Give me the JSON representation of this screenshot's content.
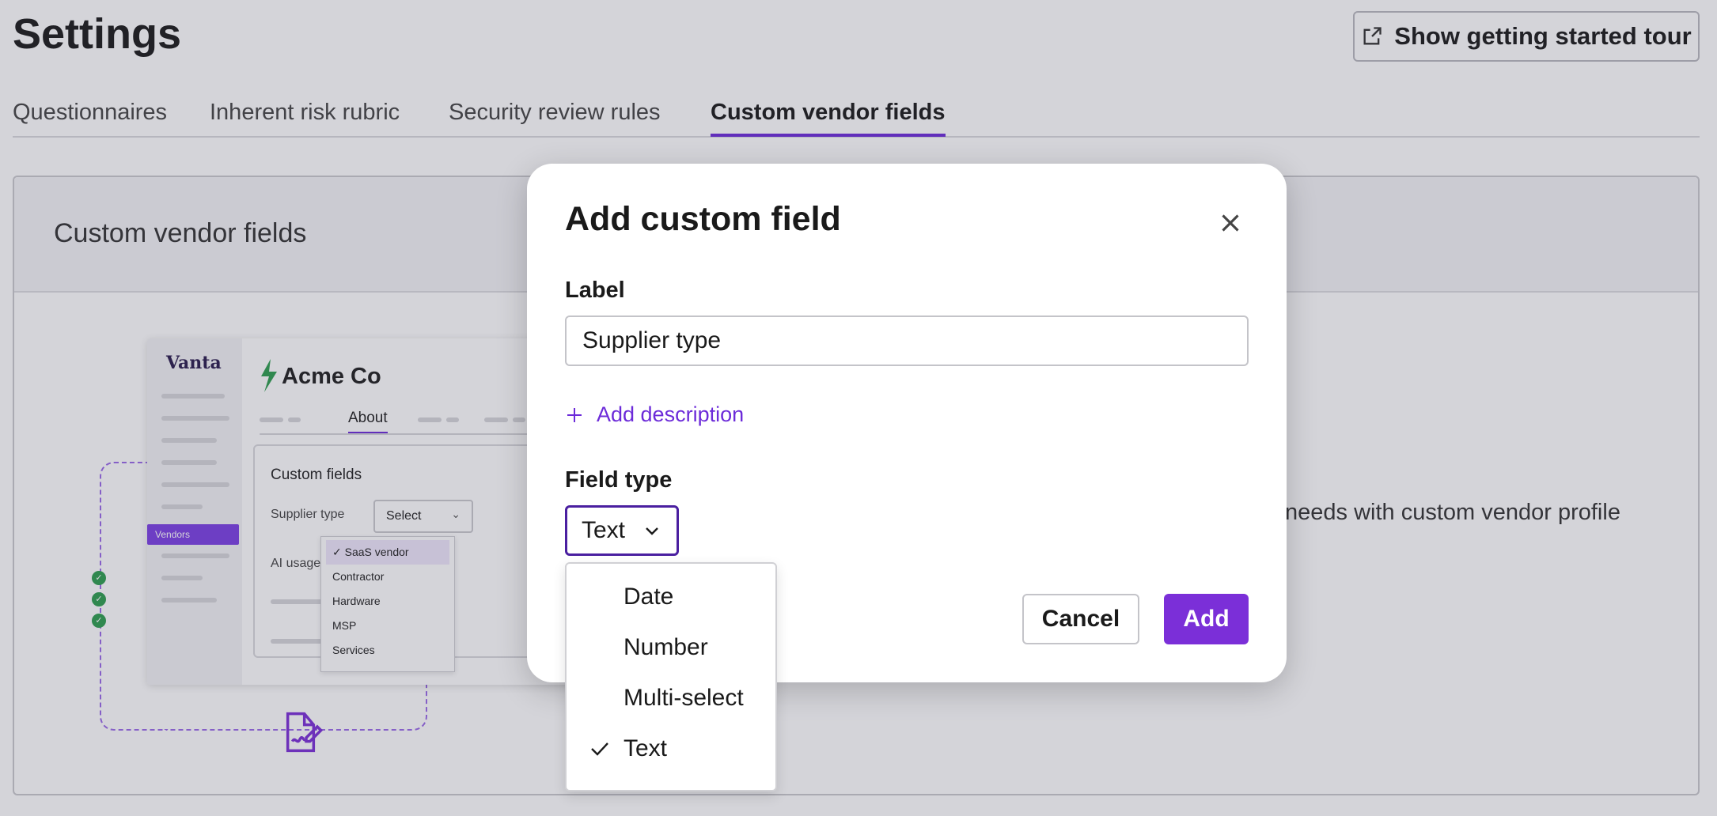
{
  "header": {
    "title": "Settings",
    "tour_button_label": "Show getting started tour"
  },
  "tabs": [
    {
      "label": "Questionnaires",
      "active": false
    },
    {
      "label": "Inherent risk rubric",
      "active": false
    },
    {
      "label": "Security review rules",
      "active": false
    },
    {
      "label": "Custom vendor fields",
      "active": true
    }
  ],
  "card": {
    "title": "Custom vendor fields",
    "description_visible": "needs with custom vendor profile"
  },
  "illustration": {
    "logo": "Vanta",
    "company": "Acme Co",
    "tab_label": "About",
    "nav_label": "Vendors",
    "panel_title": "Custom fields",
    "field1_label": "Supplier type",
    "field1_value": "Select",
    "field2_label": "AI usage",
    "options": [
      "SaaS vendor",
      "Contractor",
      "Hardware",
      "MSP",
      "Services"
    ],
    "selected_option": "SaaS vendor"
  },
  "dialog": {
    "title": "Add custom field",
    "label_heading": "Label",
    "label_value": "Supplier type",
    "add_description": "Add description",
    "field_type_heading": "Field type",
    "field_type_value": "Text",
    "cancel_label": "Cancel",
    "add_label": "Add"
  },
  "field_type_menu": {
    "options": [
      "Date",
      "Number",
      "Multi-select",
      "Text"
    ],
    "selected": "Text"
  },
  "colors": {
    "accent": "#6c2bd9",
    "primary_button": "#7b2fd8",
    "overlay": "rgba(60,60,80,0.22)"
  },
  "icons": [
    "external-link-icon",
    "close-icon",
    "plus-icon",
    "chevron-down-icon",
    "check-icon",
    "document-sign-icon"
  ]
}
